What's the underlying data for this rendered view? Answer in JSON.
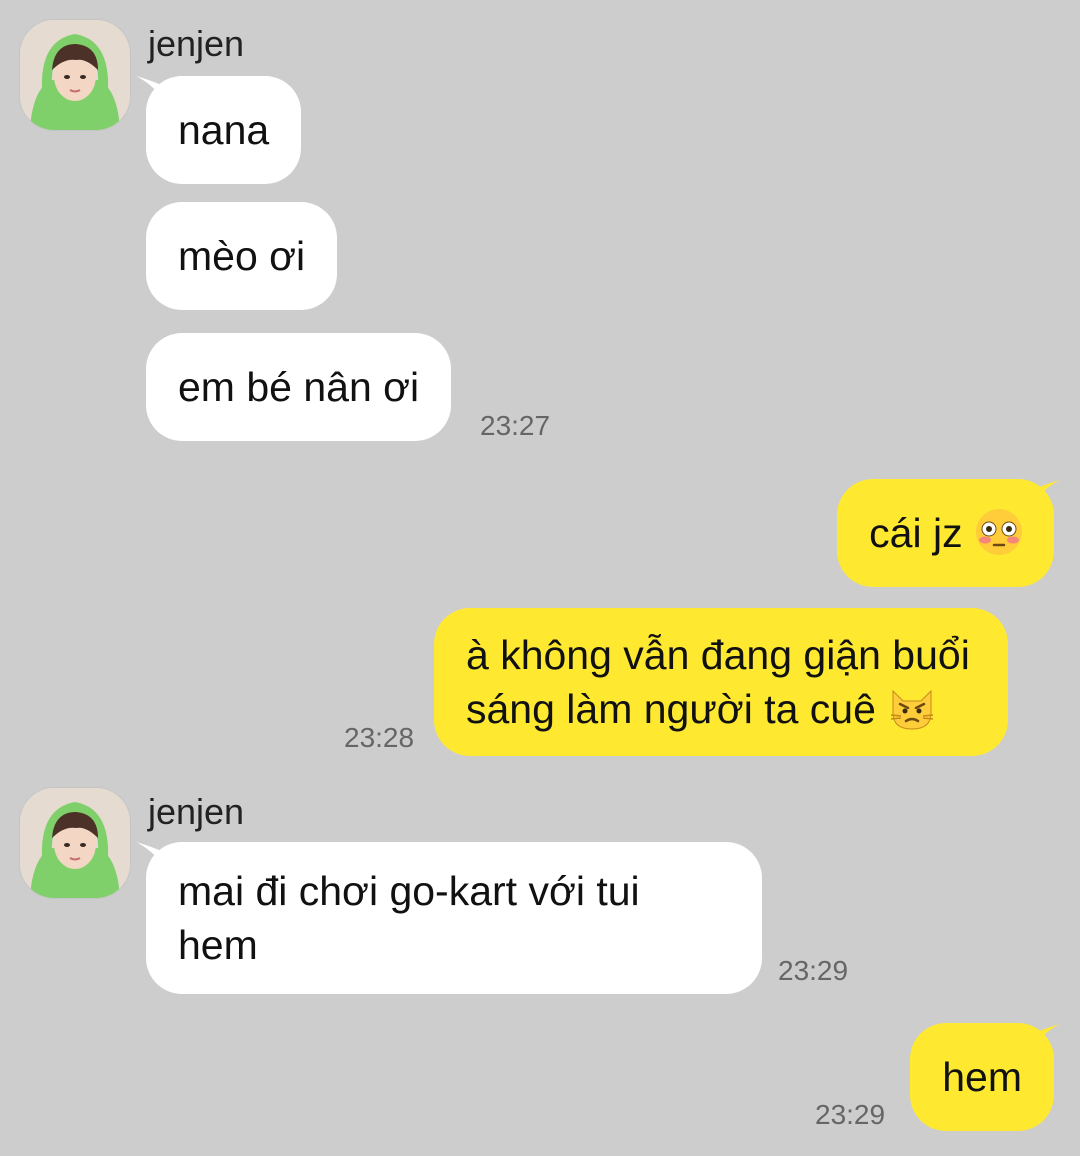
{
  "colors": {
    "background": "#cdcdcd",
    "incoming_bubble": "#ffffff",
    "outgoing_bubble": "#fee930"
  },
  "messages": {
    "m1": {
      "sender": "jenjen",
      "text": "nana"
    },
    "m2": {
      "text": "mèo ơi"
    },
    "m3": {
      "text": "em bé nân ơi",
      "time": "23:27"
    },
    "m4": {
      "text": "cái jz",
      "emoji": "flushed-face-icon"
    },
    "m5": {
      "line1": "à không vẫn đang giận buổi",
      "line2": "sáng làm người ta cuê",
      "emoji": "pouting-cat-icon",
      "time": "23:28"
    },
    "m6": {
      "sender": "jenjen",
      "line1": "mai đi chơi go-kart với tui",
      "line2": "hem",
      "time": "23:29"
    },
    "m7": {
      "text": "hem",
      "time": "23:29"
    }
  }
}
